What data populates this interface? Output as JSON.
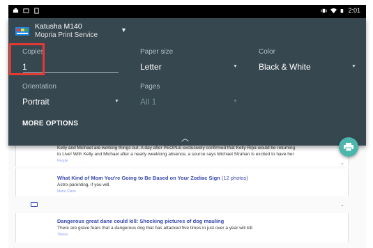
{
  "status_bar": {
    "time": "2:01"
  },
  "printer": {
    "name": "Katusha M140",
    "service": "Mopria Print Service"
  },
  "fields": {
    "copies": {
      "label": "Copies",
      "value": "1"
    },
    "paper_size": {
      "label": "Paper size",
      "value": "Letter"
    },
    "color": {
      "label": "Color",
      "value": "Black & White"
    },
    "orientation": {
      "label": "Orientation",
      "value": "Portrait"
    },
    "pages": {
      "label": "Pages",
      "value": "All 1"
    }
  },
  "more_options_label": "MORE OPTIONS",
  "articles": [
    {
      "body": "Kelly and Michael are working things out. A day after PEOPLE exclusively confirmed that Kelly Ripa would be returning",
      "body2": "to Live! With Kelly and Michael after a nearly weeklong absence, a source says Michael Strahan is excited to have her",
      "source": "People"
    },
    {
      "title": "What Kind of Mom You're Going to Be Based on Your Zodiac Sign",
      "count": "(12 photos)",
      "body": "Astro-parenting, if you will.",
      "source": "Marie Claire"
    },
    {
      "title": "Dangerous great dane could kill: Shocking pictures of dog mauling",
      "body": "There are grave fears that a dangerous dog that has attacked five times in just over a year will kill.",
      "source": "7News"
    }
  ],
  "colors": {
    "panel": "#37474f",
    "accent": "#4db6ac",
    "highlight": "#e53935",
    "link": "#3949ab"
  }
}
